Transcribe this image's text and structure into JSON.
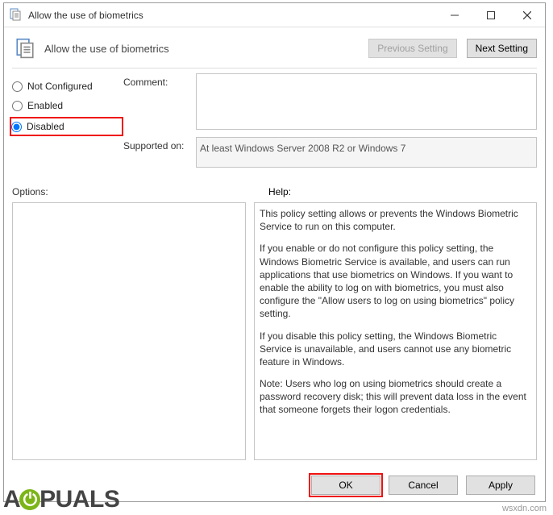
{
  "window": {
    "title": "Allow the use of biometrics"
  },
  "header": {
    "title": "Allow the use of biometrics",
    "prev": "Previous Setting",
    "next": "Next Setting"
  },
  "radios": {
    "not_configured": "Not Configured",
    "enabled": "Enabled",
    "disabled": "Disabled"
  },
  "labels": {
    "comment": "Comment:",
    "supported": "Supported on:",
    "options": "Options:",
    "help": "Help:"
  },
  "fields": {
    "comment": "",
    "supported": "At least Windows Server 2008 R2 or Windows 7"
  },
  "help": {
    "p1": "This policy setting allows or prevents the Windows Biometric Service to run on this computer.",
    "p2": "If you enable or do not configure this policy setting, the Windows Biometric Service is available, and users can run applications that use biometrics on Windows. If you want to enable the ability to log on with biometrics, you must also configure the \"Allow users to log on using biometrics\" policy setting.",
    "p3": "If you disable this policy setting, the Windows Biometric Service is unavailable, and users cannot use any biometric feature in Windows.",
    "p4": "Note: Users who log on using biometrics should create a password recovery disk; this will prevent data loss in the event that someone forgets their logon credentials."
  },
  "footer": {
    "ok": "OK",
    "cancel": "Cancel",
    "apply": "Apply"
  },
  "branding": {
    "watermark": "wsxdn.com",
    "logo_pre": "A",
    "logo_o": "⏻",
    "logo_post": "PUALS"
  }
}
